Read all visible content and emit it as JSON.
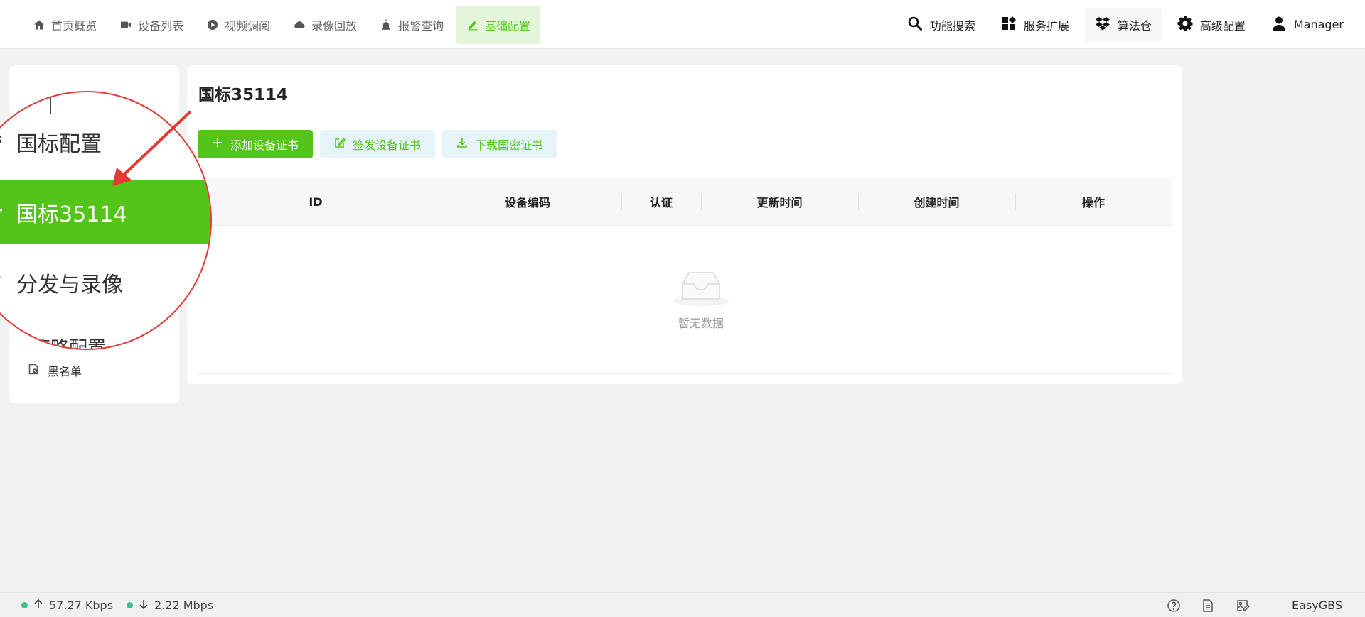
{
  "nav": {
    "items": [
      {
        "label": "首页概览",
        "icon": "home-icon"
      },
      {
        "label": "设备列表",
        "icon": "camera-icon"
      },
      {
        "label": "视频调阅",
        "icon": "play-icon"
      },
      {
        "label": "录像回放",
        "icon": "cloud-icon"
      },
      {
        "label": "报警查询",
        "icon": "alarm-icon"
      },
      {
        "label": "基础配置",
        "icon": "edit-icon",
        "active": true
      }
    ],
    "right": [
      {
        "label": "功能搜索",
        "icon": "search-icon"
      },
      {
        "label": "服务扩展",
        "icon": "apps-icon"
      },
      {
        "label": "算法仓",
        "icon": "dropbox-icon"
      },
      {
        "label": "高级配置",
        "icon": "gear-icon"
      },
      {
        "label": "Manager",
        "icon": "user-icon"
      }
    ]
  },
  "sidebar": {
    "items": [
      {
        "label": "黑名单",
        "icon": "blacklist-icon"
      }
    ]
  },
  "magnifier": {
    "items": [
      {
        "label": "国标配置"
      },
      {
        "label": "国标35114",
        "active": true
      },
      {
        "label": "分发与录像"
      }
    ],
    "partial_label": "策略配置"
  },
  "main": {
    "title": "国标35114",
    "buttons": {
      "add": "添加设备证书",
      "sign": "签发设备证书",
      "download": "下载国密证书"
    },
    "columns": [
      "ID",
      "设备编码",
      "认证",
      "更新时间",
      "创建时间",
      "操作"
    ],
    "empty_text": "暂无数据"
  },
  "status": {
    "upload": "57.27 Kbps",
    "download": "2.22 Mbps",
    "brand": "EasyGBS"
  },
  "colors": {
    "accent": "#52c41a",
    "annotation": "#e53935",
    "status_dot": "#33c58a"
  }
}
